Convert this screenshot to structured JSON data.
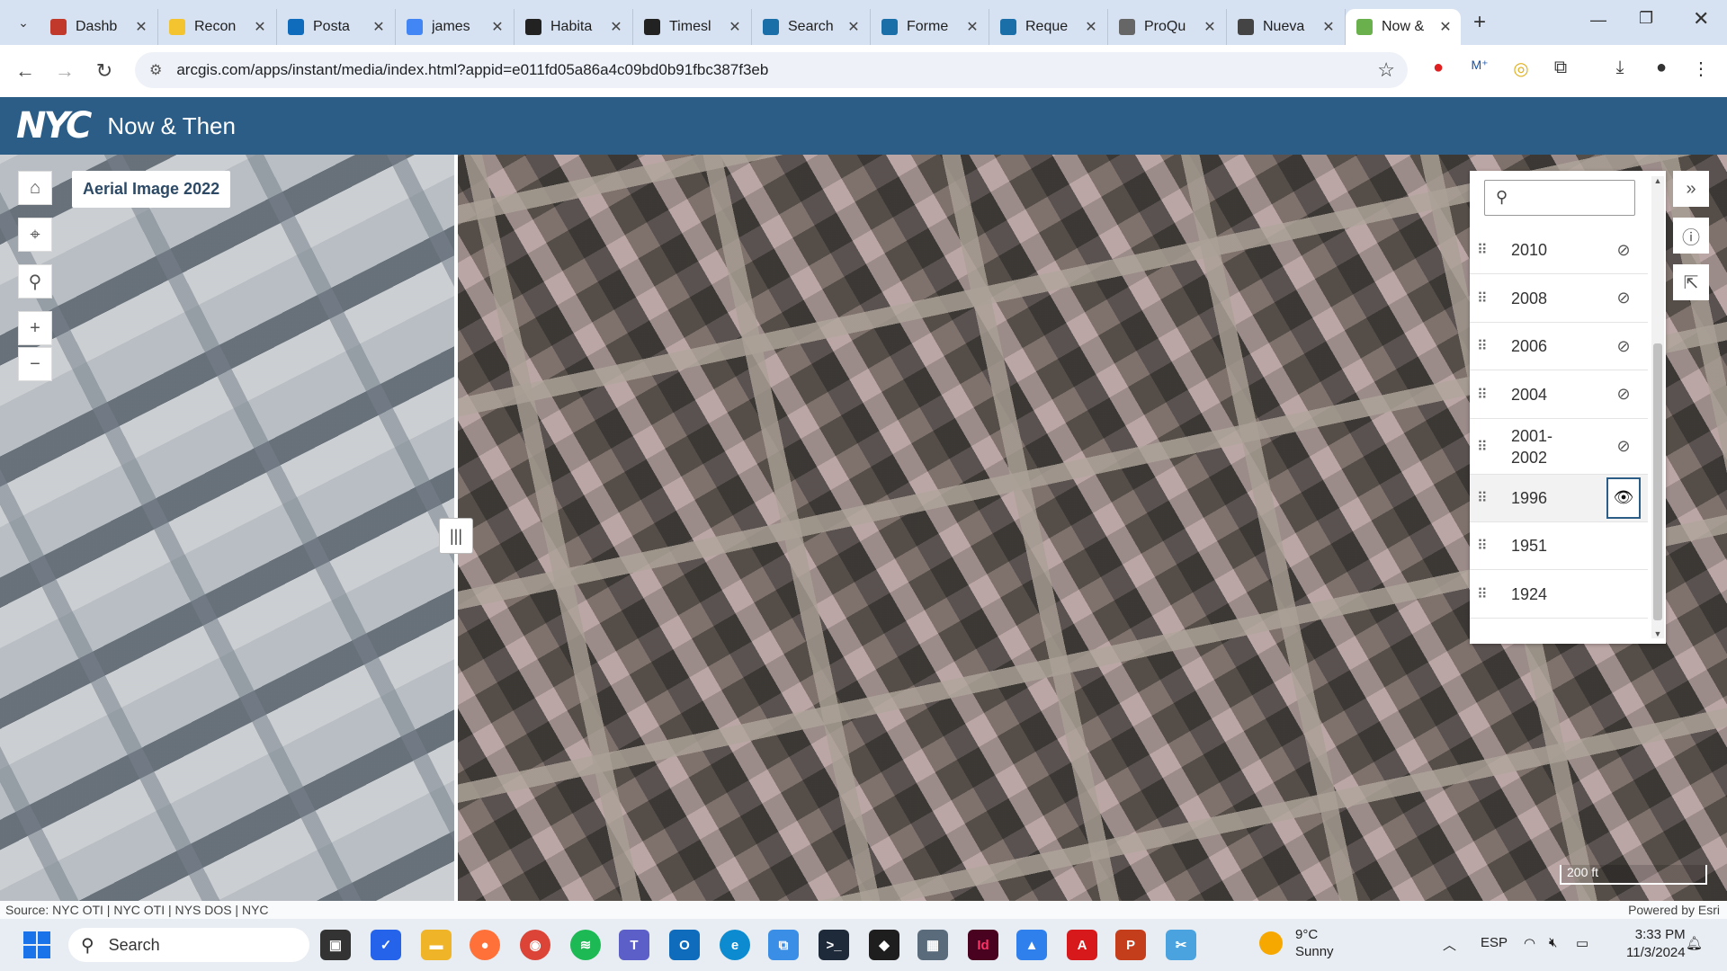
{
  "browser": {
    "tabs": [
      {
        "title": "Dashb",
        "icon": "trello-icon",
        "color": "#c0392b"
      },
      {
        "title": "Recon",
        "icon": "miro-icon",
        "color": "#f4c430"
      },
      {
        "title": "Posta",
        "icon": "outlook-icon",
        "color": "#0f6cbd"
      },
      {
        "title": "james",
        "icon": "google-icon",
        "color": "#4285f4"
      },
      {
        "title": "Habita",
        "icon": "nytimes-icon",
        "color": "#222222"
      },
      {
        "title": "Timesl",
        "icon": "nytimes-icon",
        "color": "#222222"
      },
      {
        "title": "Search",
        "icon": "proquest-icon",
        "color": "#1b6fa8"
      },
      {
        "title": "Forme",
        "icon": "proquest-icon",
        "color": "#1b6fa8"
      },
      {
        "title": "Reque",
        "icon": "proquest-icon",
        "color": "#1b6fa8"
      },
      {
        "title": "ProQu",
        "icon": "globe-icon",
        "color": "#666666"
      },
      {
        "title": "Nueva",
        "icon": "chrome-icon",
        "color": "#444444"
      },
      {
        "title": "Now &",
        "icon": "arcgis-icon",
        "color": "#6ab04c",
        "active": true
      }
    ],
    "url": "arcgis.com/apps/instant/media/index.html?appid=e011fd05a86a4c09bd0b91fbc387f3eb"
  },
  "app": {
    "logo": "NYC",
    "title": "Now & Then"
  },
  "map": {
    "left_label": "Aerial Image 2022",
    "source": "Source: NYC OTI | NYC OTI | NYS DOS | NYC",
    "powered_by": "Powered by Esri",
    "scale": "200 ft"
  },
  "layer_panel": {
    "search_placeholder": "",
    "layers": [
      {
        "year": "2010",
        "visible": false
      },
      {
        "year": "2008",
        "visible": false
      },
      {
        "year": "2006",
        "visible": false
      },
      {
        "year": "2004",
        "visible": false
      },
      {
        "year": "2001-\n2002",
        "visible": false
      },
      {
        "year": "1996",
        "visible": true
      },
      {
        "year": "1951",
        "visible": null
      },
      {
        "year": "1924",
        "visible": null
      }
    ]
  },
  "taskbar": {
    "search_label": "Search",
    "weather_temp": "9°C",
    "weather_desc": "Sunny",
    "language": "ESP",
    "time": "3:33 PM",
    "date": "11/3/2024"
  },
  "colors": {
    "header_bg": "#2c5d87",
    "tabstrip_bg": "#d6e2f2"
  }
}
